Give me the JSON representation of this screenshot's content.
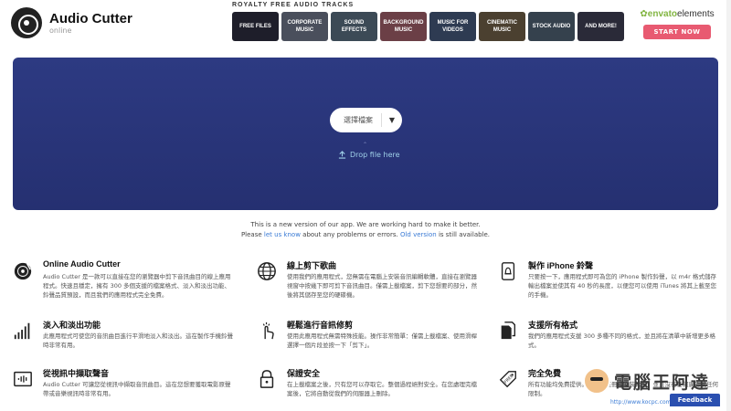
{
  "app": {
    "title": "Audio Cutter",
    "subtitle": "online"
  },
  "ad": {
    "title": "ROYALTY FREE AUDIO TRACKS",
    "tiles": [
      {
        "label": "FREE FILES",
        "color": "#1e1e2a"
      },
      {
        "label": "CORPORATE MUSIC",
        "color": "#4a4f5c"
      },
      {
        "label": "SOUND EFFECTS",
        "color": "#3c4a56"
      },
      {
        "label": "BACKGROUND MUSIC",
        "color": "#6b3f46"
      },
      {
        "label": "MUSIC FOR VIDEOS",
        "color": "#2e3b52"
      },
      {
        "label": "CINEMATIC MUSIC",
        "color": "#4b4030"
      },
      {
        "label": "STOCK AUDIO",
        "color": "#35414d"
      },
      {
        "label": "AND MORE!",
        "color": "#2a2a38"
      }
    ],
    "brand_prefix": "envato",
    "brand_suffix": "elements",
    "cta": "START NOW"
  },
  "upload": {
    "select_label": "選擇檔案",
    "drop_text": "Drop file here",
    "drop_icon": "chevrons-up-icon"
  },
  "notice": {
    "line1": "This is a new version of our app. We are working hard to make it better.",
    "please": "Please ",
    "let_us_know": "let us know",
    "about": " about any problems or errors. ",
    "old_version": "Old version",
    "still": " is still available."
  },
  "features": [
    {
      "icon": "vinyl-record-icon",
      "title": "Online Audio Cutter",
      "desc": "Audio Cutter 是一款可以直接在您的瀏覽器中剪下音訊曲目的線上應用程式。快速且穩定，擁有 300 多個支援的檔案格式、淡入和淡出功能、鈴聲品質預設，而且我們的應用程式完全免費。"
    },
    {
      "icon": "globe-icon",
      "title": "線上剪下歌曲",
      "desc": "使用我們的應用程式，您無需在電腦上安裝音訊編輯軟體，直接在瀏覽器視窗中按幾下即可剪下音訊曲目。僅需上載檔案，剪下您想要的部分，然後將其儲存至您的硬碟機。"
    },
    {
      "icon": "ringtone-bell-icon",
      "title": "製作 iPhone 鈴聲",
      "desc": "只要按一下，應用程式即可為您的 iPhone 製作鈴聲，以 m4r 格式儲存輸出檔案並使其有 40 秒的長度，以便您可以使用 iTunes 將其上載至您的手機。"
    },
    {
      "icon": "fade-bars-icon",
      "title": "淡入和淡出功能",
      "desc": "此應用程式可使您的音訊曲目進行平滑地淡入和淡出。這在製作手機鈴聲時非常有用。"
    },
    {
      "icon": "touch-hand-icon",
      "title": "輕鬆進行音訊修剪",
      "desc": "使用此應用程式無需特殊技能。操作非常簡單：僅需上載檔案、使用滑桿選擇一個片段並按一下「剪下」。"
    },
    {
      "icon": "documents-icon",
      "title": "支援所有格式",
      "desc": "我們的應用程式支援 300 多種不同的格式，並且將在清單中新增更多格式。"
    },
    {
      "icon": "video-icon",
      "title": "從視訊中擷取聲音",
      "desc": "Audio Cutter 可讓您從視訊中擷取音訊曲目。這在您想要獲取電影原聲帶或音樂視訊時非常有用。"
    },
    {
      "icon": "lock-icon",
      "title": "保證安全",
      "desc": "在上載檔案之後，只有您可以存取它。整個過程絕對安全。在您處理完檔案後，它將自動從我們的伺服器上刪除。"
    },
    {
      "icon": "free-tag-icon",
      "title": "完全免費",
      "desc": "所有功能均免費提供。您無需註冊或安裝軟體，並且沒有任何廣告或任何限制。"
    }
  ],
  "feedback_label": "Feedback",
  "watermark": {
    "text": "電腦王阿達",
    "url": "http://www.kocpc.com.tw"
  }
}
